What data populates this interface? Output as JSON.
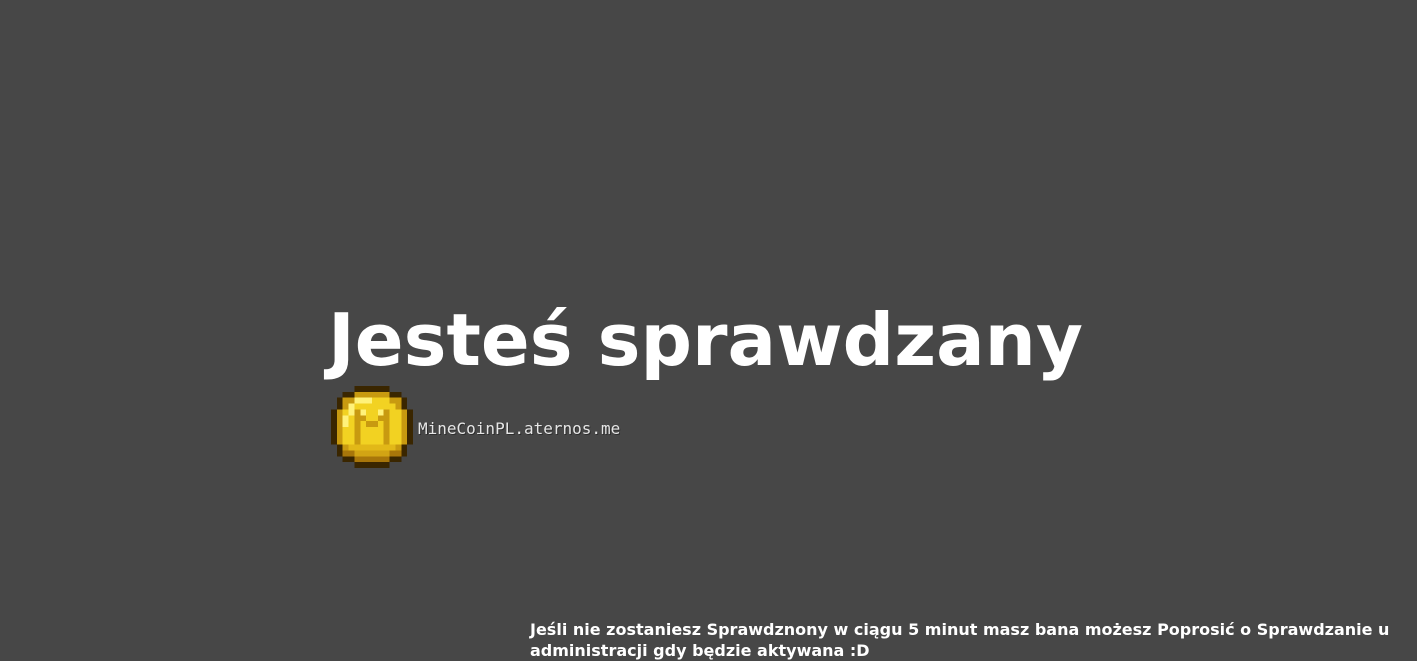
{
  "page": {
    "background_color": "#474747",
    "title": "Jesteś sprawdzany"
  },
  "server": {
    "icon": "gold-coin-m-icon",
    "coin_color": "#f2d222",
    "address": "MineCoinPL.aternos.me"
  },
  "notice": {
    "text": "Jeśli nie zostaniesz Sprawdznony w ciągu 5 minut masz bana możesz Poprosić o Sprawdzanie u administracji gdy będzie aktywana :D"
  }
}
